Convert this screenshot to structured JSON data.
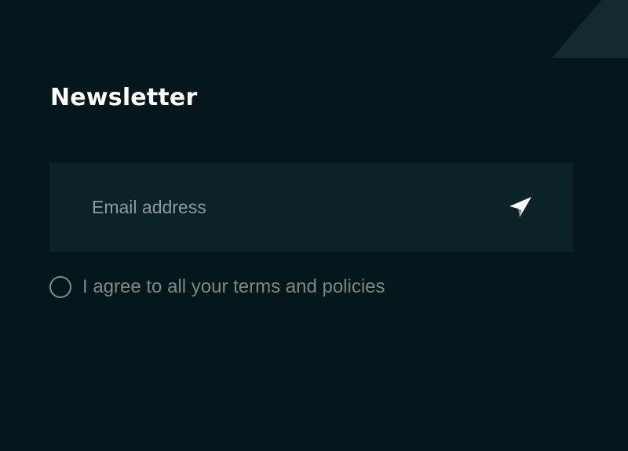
{
  "newsletter": {
    "title": "Newsletter",
    "email_placeholder": "Email address",
    "send_icon": "paper-plane-icon",
    "agree_label": "I agree to all your terms and policies"
  },
  "colors": {
    "background": "#06171b",
    "input_background": "#0b2226",
    "decor_shape": "#142a2e",
    "title": "#ffffff",
    "muted_text": "#7b8789"
  }
}
